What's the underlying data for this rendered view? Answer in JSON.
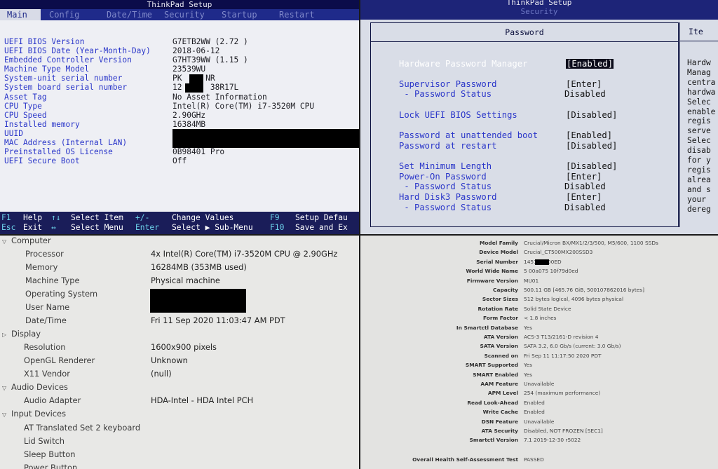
{
  "bios_main": {
    "title": "ThinkPad Setup",
    "tabs": [
      "Main",
      "Config",
      "Date/Time",
      "Security",
      "Startup",
      "Restart"
    ],
    "rows": [
      {
        "label": "UEFI BIOS Version",
        "value": "G7ETB2WW (2.72 )"
      },
      {
        "label": "UEFI BIOS Date (Year-Month-Day)",
        "value": "2018-06-12"
      },
      {
        "label": "Embedded Controller Version",
        "value": "G7HT39WW (1.15 )"
      },
      {
        "label": "Machine Type Model",
        "value": "23539WU"
      },
      {
        "label": "System-unit serial number",
        "value": "PK     NR"
      },
      {
        "label": "System board serial number",
        "value": "12      38R17L"
      },
      {
        "label": "Asset Tag",
        "value": "No Asset Information"
      },
      {
        "label": "CPU Type",
        "value": "Intel(R) Core(TM) i7-3520M CPU"
      },
      {
        "label": "CPU Speed",
        "value": "2.90GHz"
      },
      {
        "label": "Installed memory",
        "value": "16384MB"
      },
      {
        "label": "UUID",
        "value": ""
      },
      {
        "label": "MAC Address (Internal LAN)",
        "value": ""
      },
      {
        "label": "Preinstalled OS License",
        "value": "0B98401 Pro"
      },
      {
        "label": "UEFI Secure Boot",
        "value": "Off"
      }
    ],
    "footer": {
      "row1": {
        "k1": "F1",
        "l1": "Help",
        "k2": "↑↓",
        "l2": "Select Item",
        "k3": "+/-",
        "l3": "Change Values",
        "k4": "F9",
        "l4": "Setup Defau"
      },
      "row2": {
        "k1": "Esc",
        "l1": "Exit",
        "k2": "↔",
        "l2": "Select Menu",
        "k3": "Enter",
        "l3": "Select ▶ Sub-Menu",
        "k4": "F10",
        "l4": "Save and Ex"
      }
    }
  },
  "bios_security": {
    "title": "ThinkPad Setup",
    "subtitle": "Security",
    "panel_heading": "Password",
    "side_heading": "Ite",
    "items": [
      {
        "label": "Hardware Password Manager",
        "value": "[Enabled]",
        "selected": true
      },
      {
        "label": "Supervisor Password",
        "value": "[Enter]"
      },
      {
        "label": " - Password Status",
        "value": "Disabled"
      },
      {
        "label": "Lock UEFI BIOS Settings",
        "value": "[Disabled]"
      },
      {
        "label": "Password at unattended boot",
        "value": "[Enabled]"
      },
      {
        "label": "Password at restart",
        "value": "[Disabled]"
      },
      {
        "label": "Set Minimum Length",
        "value": "[Disabled]"
      },
      {
        "label": "Power-On Password",
        "value": "[Enter]"
      },
      {
        "label": " - Password Status",
        "value": "Disabled"
      },
      {
        "label": "Hard Disk3 Password",
        "value": "[Enter]"
      },
      {
        "label": " - Password Status",
        "value": "Disabled"
      }
    ],
    "help_text": [
      "Hardw",
      "Manag",
      "centra",
      "hardwa",
      "Selec",
      "enable",
      "regis",
      "serve",
      "Selec",
      "disab",
      "for y",
      "regis",
      "alrea",
      "and s",
      "your",
      "dereg"
    ]
  },
  "system_info": {
    "sections": [
      {
        "name": "Computer",
        "items": [
          {
            "key": "Processor",
            "value": "4x Intel(R) Core(TM) i7-3520M CPU @ 2.90GHz"
          },
          {
            "key": "Memory",
            "value": "16284MB (353MB used)"
          },
          {
            "key": "Machine Type",
            "value": "Physical machine"
          },
          {
            "key": "Operating System",
            "value": ""
          },
          {
            "key": "User Name",
            "value": ""
          },
          {
            "key": "Date/Time",
            "value": "Fri 11 Sep 2020 11:03:47 AM PDT"
          }
        ]
      },
      {
        "name": "Display",
        "items": [
          {
            "key": "Resolution",
            "value": "1600x900 pixels"
          },
          {
            "key": "OpenGL Renderer",
            "value": "Unknown"
          },
          {
            "key": "X11 Vendor",
            "value": "(null)"
          }
        ]
      },
      {
        "name": "Audio Devices",
        "items": [
          {
            "key": "Audio Adapter",
            "value": "HDA-Intel - HDA Intel PCH"
          }
        ]
      },
      {
        "name": "Input Devices",
        "items": [
          {
            "key": "AT Translated Set 2 keyboard",
            "value": ""
          },
          {
            "key": "Lid Switch",
            "value": ""
          },
          {
            "key": "Sleep Button",
            "value": ""
          },
          {
            "key": "Power Button",
            "value": ""
          }
        ]
      }
    ]
  },
  "disk_info": {
    "rows": [
      {
        "key": "Model Family",
        "value": "Crucial/Micron BX/MX1/2/3/500, M5/600, 1100 SSDs"
      },
      {
        "key": "Device Model",
        "value": "Crucial_CT500MX200SSD3"
      },
      {
        "key": "Serial Number",
        "value": "1451      D0ED"
      },
      {
        "key": "World Wide Name",
        "value": "5 00a075 10f79d0ed"
      },
      {
        "key": "Firmware Version",
        "value": "MU01"
      },
      {
        "key": "Capacity",
        "value": "500.11 GB [465.76 GiB, 500107862016 bytes]"
      },
      {
        "key": "Sector Sizes",
        "value": "512 bytes logical, 4096 bytes physical"
      },
      {
        "key": "Rotation Rate",
        "value": "Solid State Device"
      },
      {
        "key": "Form Factor",
        "value": "< 1.8 inches"
      },
      {
        "key": "In Smartctl Database",
        "value": "Yes"
      },
      {
        "key": "ATA Version",
        "value": "ACS-3 T13/2161-D revision 4"
      },
      {
        "key": "SATA Version",
        "value": "SATA 3.2, 6.0 Gb/s (current: 3.0 Gb/s)"
      },
      {
        "key": "Scanned on",
        "value": "Fri Sep 11 11:17:50 2020 PDT"
      },
      {
        "key": "SMART Supported",
        "value": "Yes"
      },
      {
        "key": "SMART Enabled",
        "value": "Yes"
      },
      {
        "key": "AAM Feature",
        "value": "Unavailable"
      },
      {
        "key": "APM Level",
        "value": "254 (maximum performance)"
      },
      {
        "key": "Read Look-Ahead",
        "value": "Enabled"
      },
      {
        "key": "Write Cache",
        "value": "Enabled"
      },
      {
        "key": "DSN Feature",
        "value": "Unavailable"
      },
      {
        "key": "ATA Security",
        "value": "Disabled, NOT FROZEN [SEC1]"
      },
      {
        "key": "Smartctl Version",
        "value": "7.1 2019-12-30 r5022"
      }
    ],
    "health": {
      "key": "Overall Health Self-Assessment Test",
      "value": "PASSED"
    }
  }
}
